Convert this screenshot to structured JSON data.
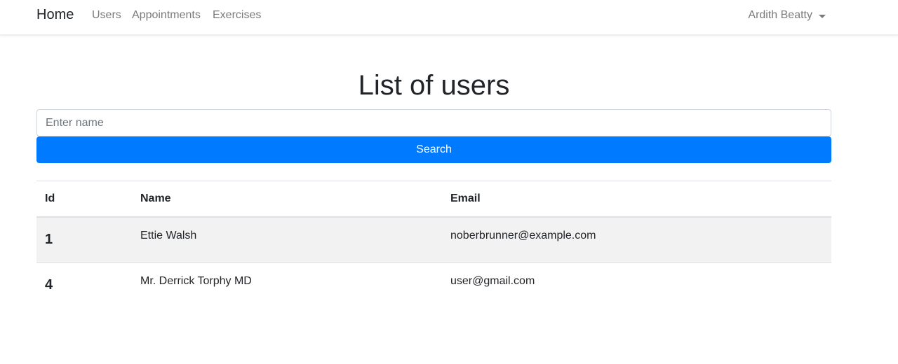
{
  "nav": {
    "brand": "Home",
    "links": [
      "Users",
      "Appointments",
      "Exercises"
    ],
    "user": "Ardith Beatty"
  },
  "page": {
    "title": "List of users"
  },
  "search": {
    "placeholder": "Enter name",
    "value": "",
    "button_label": "Search"
  },
  "table": {
    "headers": [
      "Id",
      "Name",
      "Email"
    ],
    "rows": [
      {
        "id": "1",
        "name": "Ettie Walsh",
        "email": "noberbrunner@example.com"
      },
      {
        "id": "4",
        "name": "Mr. Derrick Torphy MD",
        "email": "user@gmail.com"
      }
    ]
  },
  "colors": {
    "primary": "#007bff",
    "stripe": "#f2f2f2",
    "nav_text": "#7a7a7a"
  }
}
